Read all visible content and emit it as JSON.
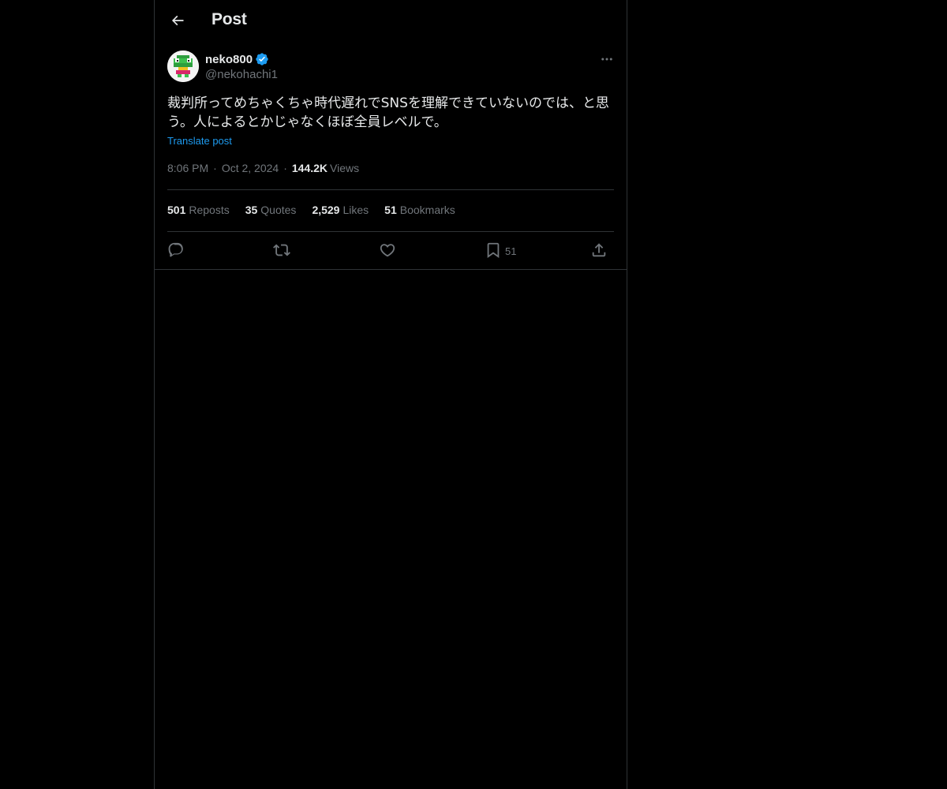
{
  "header": {
    "title": "Post"
  },
  "post": {
    "author_name": "neko800",
    "handle": "@nekohachi1",
    "text": "裁判所ってめちゃくちゃ時代遅れでSNSを理解できていないのでは、と思う。人によるとかじゃなくほぼ全員レベルで。",
    "translate_label": "Translate post",
    "time": "8:06 PM",
    "date": "Oct 2, 2024",
    "views_count": "144.2K",
    "views_label": "Views",
    "separator": "·"
  },
  "stats": {
    "reposts": {
      "count": "501",
      "label": "Reposts"
    },
    "quotes": {
      "count": "35",
      "label": "Quotes"
    },
    "likes": {
      "count": "2,529",
      "label": "Likes"
    },
    "bookmarks": {
      "count": "51",
      "label": "Bookmarks"
    }
  },
  "actions": {
    "bookmark_count": "51",
    "icons": [
      "reply-icon",
      "repost-icon",
      "like-icon",
      "bookmark-icon",
      "share-icon"
    ]
  },
  "colors": {
    "background": "#000000",
    "text": "#e7e9ea",
    "secondary": "#71767b",
    "accent": "#1d9bf0",
    "border": "#2f3336"
  }
}
